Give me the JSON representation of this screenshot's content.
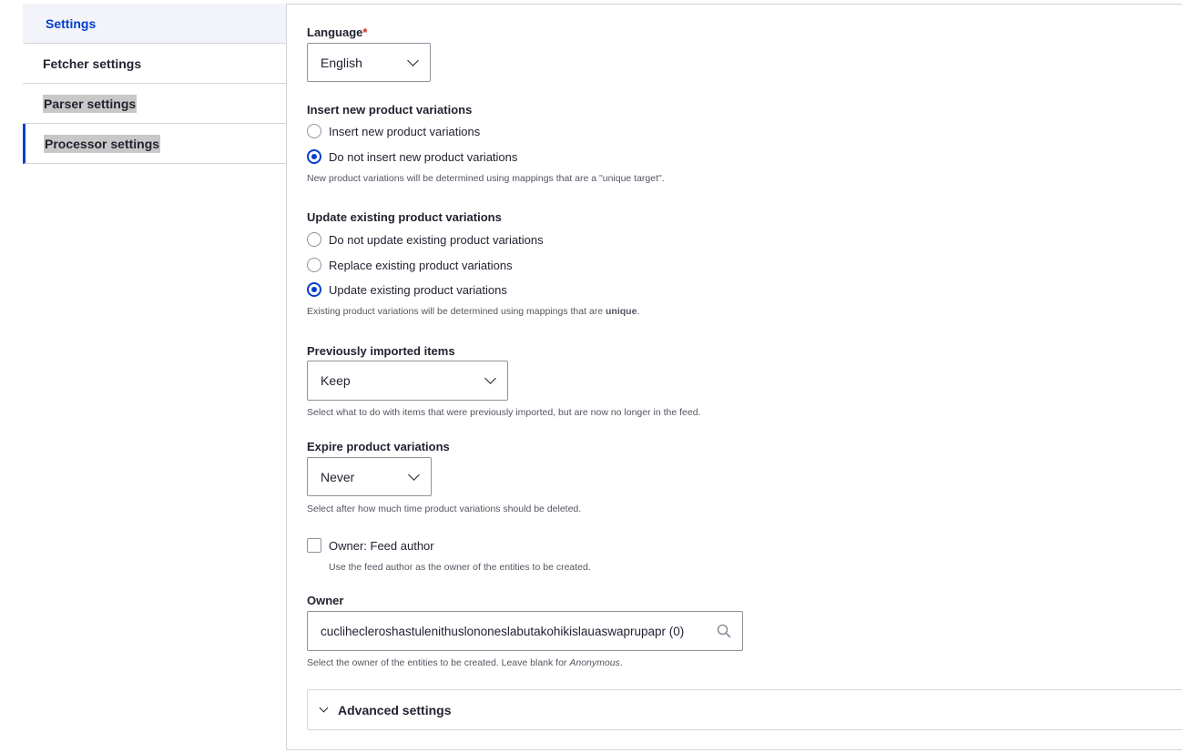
{
  "tabs": {
    "settings": "Settings",
    "fetcher": "Fetcher settings",
    "parser": "Parser settings",
    "processor": "Processor settings"
  },
  "language": {
    "label": "Language",
    "required_mark": "*",
    "value": "English"
  },
  "insert": {
    "label": "Insert new product variations",
    "options": [
      "Insert new product variations",
      "Do not insert new product variations"
    ],
    "selected": 1,
    "description": "New product variations will be determined using mappings that are a \"unique target\"."
  },
  "update": {
    "label": "Update existing product variations",
    "options": [
      "Do not update existing product variations",
      "Replace existing product variations",
      "Update existing product variations"
    ],
    "selected": 2,
    "description_prefix": "Existing product variations will be determined using mappings that are ",
    "description_bold": "unique",
    "description_suffix": "."
  },
  "previously": {
    "label": "Previously imported items",
    "value": "Keep",
    "description": "Select what to do with items that were previously imported, but are now no longer in the feed."
  },
  "expire": {
    "label": "Expire product variations",
    "value": "Never",
    "description": "Select after how much time product variations should be deleted."
  },
  "owner_feed": {
    "label": "Owner: Feed author",
    "checked": false,
    "description": "Use the feed author as the owner of the entities to be created."
  },
  "owner": {
    "label": "Owner",
    "value": "cuclihecleroshastulenithuslononeslabutakohikislauaswaprupapr (0)",
    "description_prefix": "Select the owner of the entities to be created. Leave blank for ",
    "description_italic": "Anonymous",
    "description_suffix": "."
  },
  "advanced": {
    "label": "Advanced settings"
  },
  "colors": {
    "accent": "#003ecc",
    "required": "#dc2323",
    "border": "#8e929c"
  }
}
